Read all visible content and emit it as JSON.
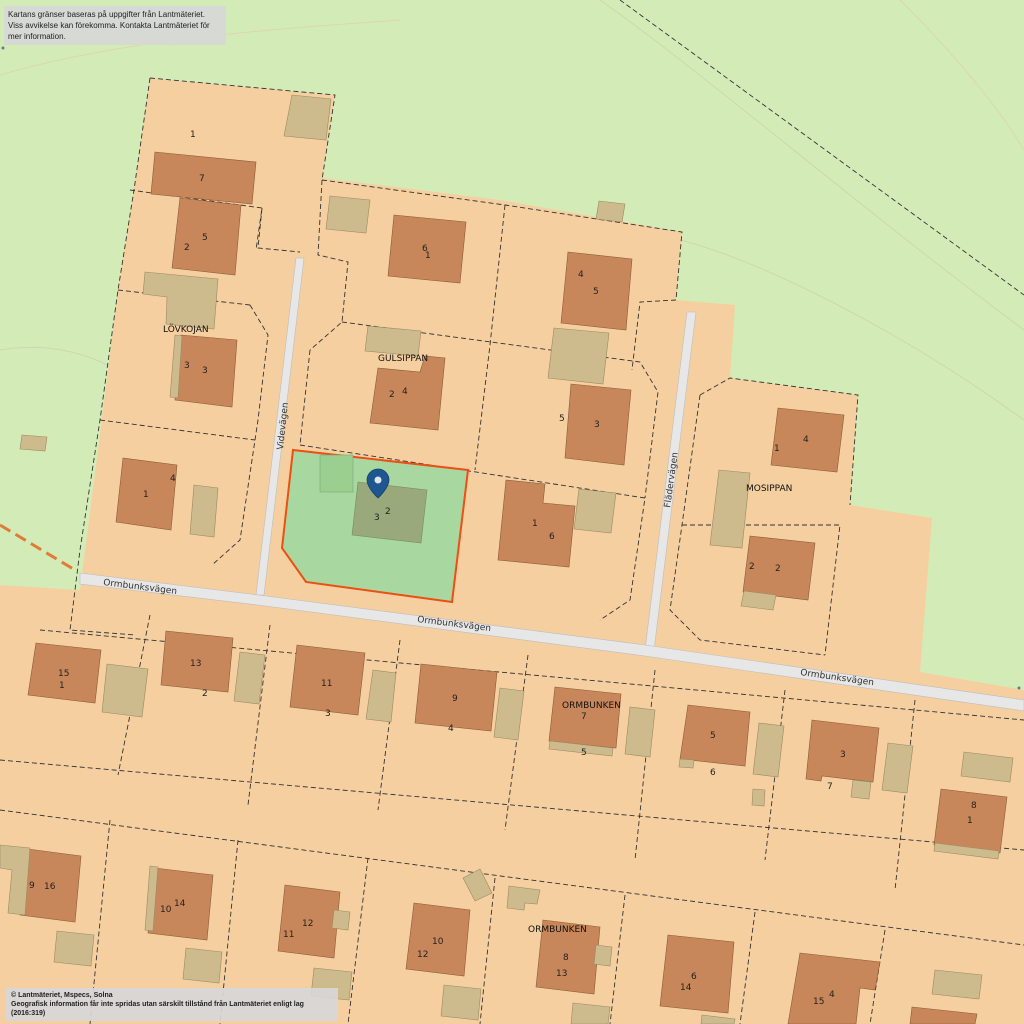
{
  "notices": {
    "top_line1": "Kartans gränser baseras på uppgifter från Lantmäteriet.",
    "top_line2": "Viss avvikelse kan förekomma. Kontakta Lantmäteriet för mer information.",
    "copyright": "© Lantmäteriet, Mspecs, Solna",
    "license": "Geografisk information får inte spridas utan särskilt tillstånd från Lantmäteriet enligt lag (2016:319)"
  },
  "streets": {
    "videvagen": "Videvägen",
    "fladervagen": "Flädervägen",
    "ormbunksvagen": "Ormbunksvägen"
  },
  "areas": {
    "lovkojan": "LÖVKOJAN",
    "gulsippan": "GULSIPPAN",
    "mosippan": "MOSIPPAN",
    "ormbunken": "ORMBUNKEN"
  },
  "marker": {
    "label": "selected-property",
    "icon": "map-pin-icon"
  },
  "colors": {
    "grass": "#d3ecb7",
    "plot": "#f5cfa0",
    "building": "#c8875a",
    "annex": "#cdbb8e",
    "road": "#e7e7e7",
    "selection_fill": "#a8d8a0",
    "selection_stroke": "#ec4f14",
    "marker": "#1d5690"
  },
  "labels": {
    "l1": "1",
    "l7": "7",
    "l2a": "2",
    "l5a": "5",
    "l3a": "3",
    "l3b": "3",
    "l4a": "4",
    "l1b": "1",
    "l6a": "6",
    "l1c": "1",
    "l4b": "4",
    "l5b": "5",
    "l2b": "2",
    "l4c": "4",
    "l5c": "5",
    "l3c": "3",
    "l3d": "3",
    "l2c": "2",
    "l1d": "1",
    "l6b": "6",
    "l1e": "1",
    "l4d": "4",
    "l2d": "2",
    "l2e": "2",
    "l15": "15",
    "l1f": "1",
    "l13": "13",
    "l2f": "2",
    "l11": "11",
    "l3e": "3",
    "l9": "9",
    "l4e": "4",
    "l7b": "7",
    "l5d": "5",
    "l5e": "5",
    "l6c": "6",
    "l3f": "3",
    "l7c": "7",
    "l8": "8",
    "l1g": "1",
    "l9b": "9",
    "l16": "16",
    "l10": "10",
    "l14": "14",
    "l11b": "11",
    "l12": "12",
    "l10b": "10",
    "l12b": "12",
    "l8b": "8",
    "l13b": "13",
    "l6d": "6",
    "l14b": "14",
    "l15b": "15",
    "l4f": "4"
  }
}
